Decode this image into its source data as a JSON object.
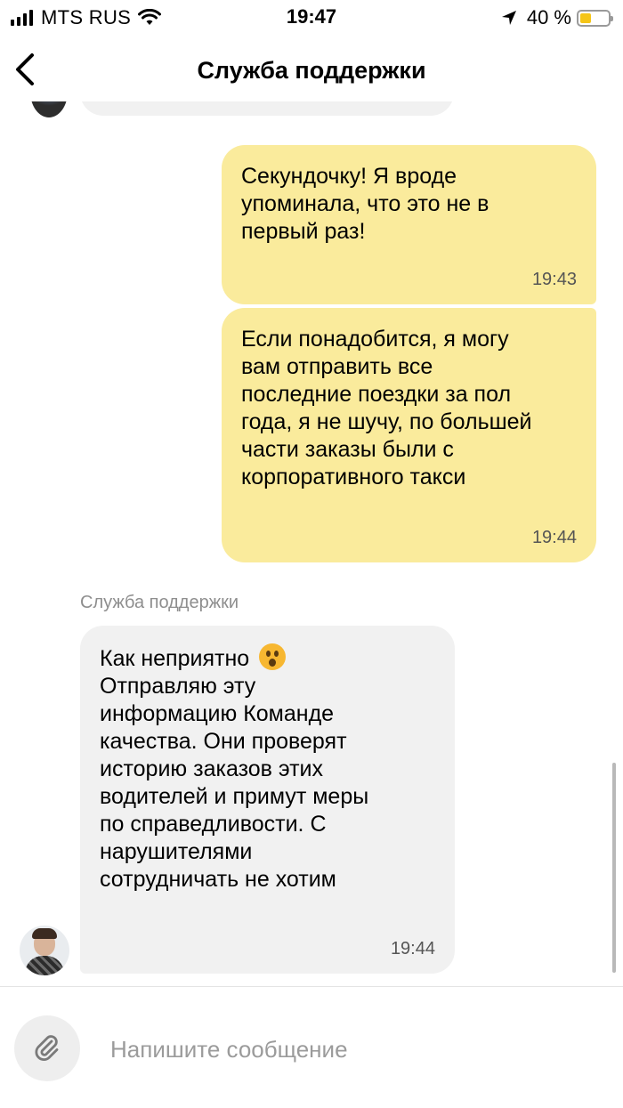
{
  "status_bar": {
    "carrier": "MTS RUS",
    "time": "19:47",
    "battery_percent": "40 %",
    "battery_level": 0.4,
    "icons": [
      "signal-icon",
      "wifi-icon",
      "location-arrow-icon",
      "battery-icon"
    ]
  },
  "header": {
    "title": "Служба поддержки",
    "back_icon": "chevron-left-icon"
  },
  "messages": [
    {
      "direction": "outgoing",
      "text": "Секундочку! Я вроде\nупоминала, что это не в\nпервый раз!",
      "time": "19:43"
    },
    {
      "direction": "outgoing",
      "text": "Если понадобится, я могу\nвам отправить все\nпоследние поездки за пол\nгода, я не шучу, по большей\nчасти заказы были с\nкорпоративного такси",
      "time": "19:44"
    },
    {
      "direction": "incoming",
      "sender": "Служба поддержки",
      "text_first_line": "Как неприятно",
      "emoji": "hushed-face",
      "text": "Отправляю эту\nинформацию Команде\nкачества. Они проверят\nисторию заказов этих\nводителей и примут меры\nпо справедливости. С\nнарушителями\nсотрудничать не хотим",
      "time": "19:44"
    }
  ],
  "composer": {
    "placeholder": "Напишите сообщение",
    "attach_icon": "paperclip-icon"
  },
  "colors": {
    "outgoing_bubble": "#faeb9c",
    "incoming_bubble": "#f1f1f1",
    "battery_fill": "#f5c518"
  }
}
